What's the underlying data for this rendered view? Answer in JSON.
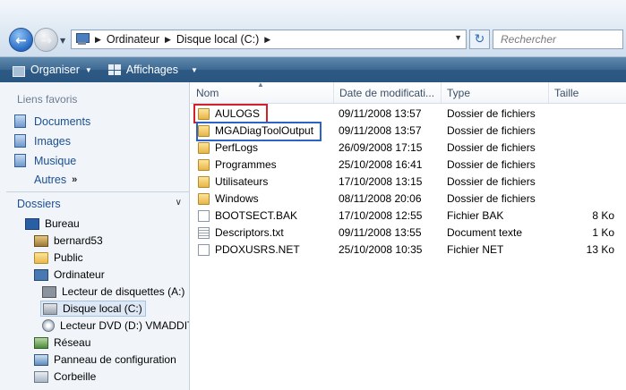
{
  "address": {
    "breadcrumbs": [
      "Ordinateur",
      "Disque local (C:)"
    ],
    "search_placeholder": "Rechercher",
    "icons": {
      "back": "back-arrow-icon",
      "forward": "forward-arrow-icon",
      "refresh": "refresh-icon",
      "computer": "computer-icon"
    }
  },
  "toolbar": {
    "organize_label": "Organiser",
    "views_label": "Affichages"
  },
  "sidebar": {
    "favorites_title": "Liens favoris",
    "favorites": [
      {
        "label": "Documents",
        "icon": "documents-icon"
      },
      {
        "label": "Images",
        "icon": "images-icon"
      },
      {
        "label": "Musique",
        "icon": "music-icon"
      }
    ],
    "more_label": "Autres",
    "more_glyph": "»",
    "folders_title": "Dossiers",
    "tree": [
      {
        "label": "Bureau",
        "icon": "desktop-icon"
      },
      {
        "label": "bernard53",
        "icon": "user-folder-icon"
      },
      {
        "label": "Public",
        "icon": "folder-icon"
      },
      {
        "label": "Ordinateur",
        "icon": "computer-icon"
      },
      {
        "label": "Lecteur de disquettes (A:)",
        "icon": "floppy-drive-icon"
      },
      {
        "label": "Disque local (C:)",
        "icon": "local-disk-icon",
        "selected": true
      },
      {
        "label": "Lecteur DVD (D:) VMADDIT",
        "icon": "dvd-drive-icon"
      },
      {
        "label": "Réseau",
        "icon": "network-icon"
      },
      {
        "label": "Panneau de configuration",
        "icon": "control-panel-icon"
      },
      {
        "label": "Corbeille",
        "icon": "recycle-bin-icon"
      }
    ]
  },
  "file_list": {
    "columns": [
      "Nom",
      "Date de modificati...",
      "Type",
      "Taille"
    ],
    "rows": [
      {
        "name": "AULOGS",
        "date": "09/11/2008 13:57",
        "type": "Dossier de fichiers",
        "size": "",
        "icon": "folder-icon",
        "highlight": "red"
      },
      {
        "name": "MGADiagToolOutput",
        "date": "09/11/2008 13:57",
        "type": "Dossier de fichiers",
        "size": "",
        "icon": "folder-icon",
        "highlight": "blue"
      },
      {
        "name": "PerfLogs",
        "date": "26/09/2008 17:15",
        "type": "Dossier de fichiers",
        "size": "",
        "icon": "folder-icon"
      },
      {
        "name": "Programmes",
        "date": "25/10/2008 16:41",
        "type": "Dossier de fichiers",
        "size": "",
        "icon": "folder-icon"
      },
      {
        "name": "Utilisateurs",
        "date": "17/10/2008 13:15",
        "type": "Dossier de fichiers",
        "size": "",
        "icon": "folder-icon"
      },
      {
        "name": "Windows",
        "date": "08/11/2008 20:06",
        "type": "Dossier de fichiers",
        "size": "",
        "icon": "folder-icon"
      },
      {
        "name": "BOOTSECT.BAK",
        "date": "17/10/2008 12:55",
        "type": "Fichier BAK",
        "size": "8 Ko",
        "icon": "file-icon"
      },
      {
        "name": "Descriptors.txt",
        "date": "09/11/2008 13:55",
        "type": "Document texte",
        "size": "1 Ko",
        "icon": "text-file-icon"
      },
      {
        "name": "PDOXUSRS.NET",
        "date": "25/10/2008 10:35",
        "type": "Fichier NET",
        "size": "13 Ko",
        "icon": "file-icon"
      }
    ]
  },
  "colors": {
    "highlight_red": "#d4202a",
    "highlight_blue": "#2c63c9",
    "toolbar": "#3d6892"
  }
}
